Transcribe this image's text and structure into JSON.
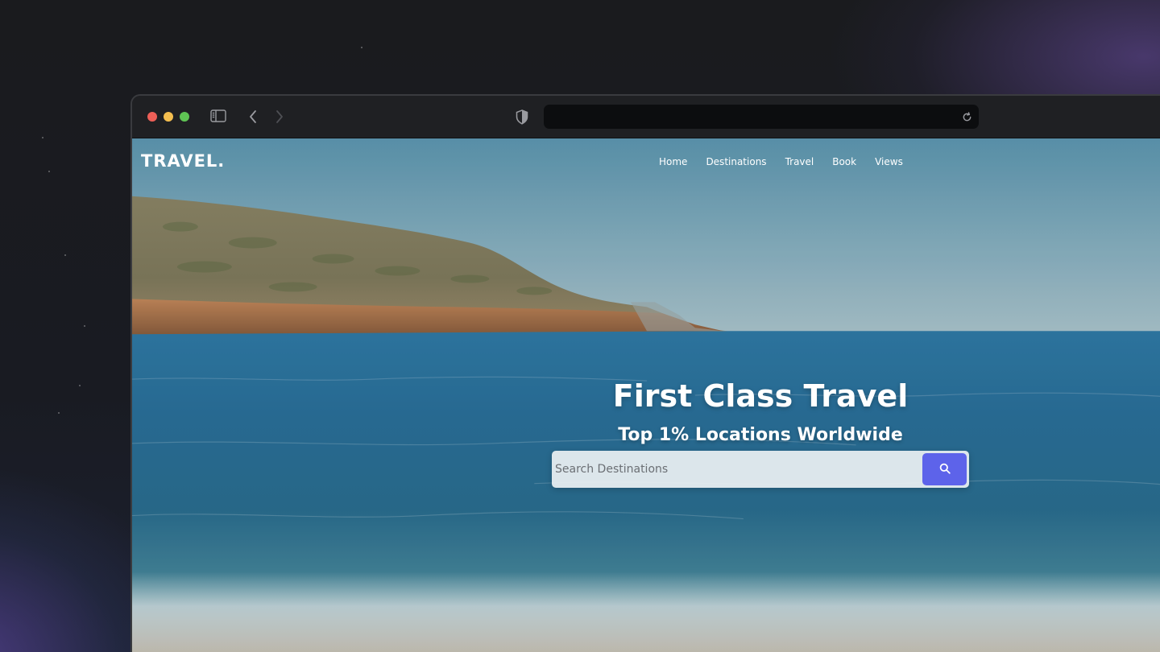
{
  "browser": {
    "address_value": "",
    "icons": {
      "sidebar": "sidebar-icon",
      "back": "chevron-left-icon",
      "forward": "chevron-right-icon",
      "privacy": "shield-icon",
      "reload": "reload-icon"
    }
  },
  "site": {
    "logo": "TRAVEL.",
    "nav": [
      "Home",
      "Destinations",
      "Travel",
      "Book",
      "Views"
    ],
    "hero": {
      "title": "First Class Travel",
      "subtitle": "Top 1% Locations Worldwide"
    },
    "search": {
      "placeholder": "Search Destinations",
      "value": "",
      "button_icon": "search-icon"
    }
  },
  "colors": {
    "accent": "#5d63ea",
    "traffic_red": "#ed5f57",
    "traffic_yellow": "#f4be4f",
    "traffic_green": "#5fc454"
  }
}
